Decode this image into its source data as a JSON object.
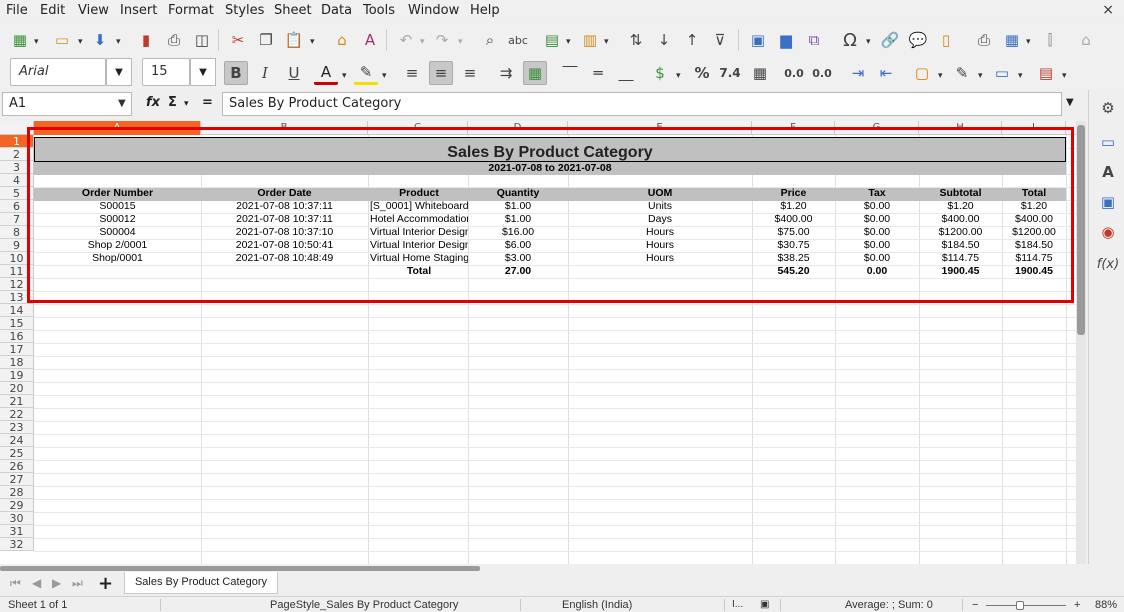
{
  "menu": [
    "File",
    "Edit",
    "View",
    "Insert",
    "Format",
    "Styles",
    "Sheet",
    "Data",
    "Tools",
    "Window",
    "Help"
  ],
  "window": {
    "close": "×"
  },
  "font": {
    "name": "Arial",
    "size": "15"
  },
  "formula_bar": {
    "cell_ref": "A1",
    "fx": "fx",
    "sigma": "Σ",
    "equals": "=",
    "content": "Sales By Product Category"
  },
  "columns": [
    "A",
    "B",
    "C",
    "D",
    "E",
    "F",
    "G",
    "H",
    "I"
  ],
  "rows": [
    "1",
    "2",
    "3",
    "4",
    "5",
    "6",
    "7",
    "8",
    "9",
    "10",
    "11",
    "12",
    "13",
    "14",
    "15",
    "16",
    "17",
    "18",
    "19",
    "20",
    "21",
    "22",
    "23",
    "24",
    "25",
    "26",
    "27",
    "28",
    "29",
    "30",
    "31",
    "32"
  ],
  "report": {
    "title": "Sales By Product Category",
    "date_range": "2021-07-08 to 2021-07-08",
    "headers": [
      "Order Number",
      "Order Date",
      "Product",
      "Quantity",
      "UOM",
      "Price",
      "Tax",
      "Subtotal",
      "Total"
    ],
    "rows": [
      [
        "S00015",
        "2021-07-08 10:37:11",
        "[S_0001] Whiteboard",
        "$1.00",
        "Units",
        "$1.20",
        "$0.00",
        "$1.20",
        "$1.20"
      ],
      [
        "S00012",
        "2021-07-08 10:37:11",
        "Hotel Accommodation",
        "$1.00",
        "Days",
        "$400.00",
        "$0.00",
        "$400.00",
        "$400.00"
      ],
      [
        "S00004",
        "2021-07-08 10:37:10",
        "Virtual Interior Design",
        "$16.00",
        "Hours",
        "$75.00",
        "$0.00",
        "$1200.00",
        "$1200.00"
      ],
      [
        "Shop 2/0001",
        "2021-07-08 10:50:41",
        "Virtual Interior Design",
        "$6.00",
        "Hours",
        "$30.75",
        "$0.00",
        "$184.50",
        "$184.50"
      ],
      [
        "Shop/0001",
        "2021-07-08 10:48:49",
        "Virtual Home Staging",
        "$3.00",
        "Hours",
        "$38.25",
        "$0.00",
        "$114.75",
        "$114.75"
      ]
    ],
    "totals": {
      "label": "Total",
      "quantity": "27.00",
      "price": "545.20",
      "tax": "0.00",
      "subtotal": "1900.45",
      "total": "1900.45"
    }
  },
  "tabs": {
    "sheet_name": "Sales By Product Category"
  },
  "status": {
    "sheet": "Sheet 1 of 1",
    "page_style": "PageStyle_Sales By Product Category",
    "language": "English (India)",
    "summary": "Average: ; Sum: 0",
    "zoom": "88%"
  },
  "colors": {
    "highlight": "#e00000",
    "selected_header": "#f26522",
    "band": "#c0c0c0"
  }
}
